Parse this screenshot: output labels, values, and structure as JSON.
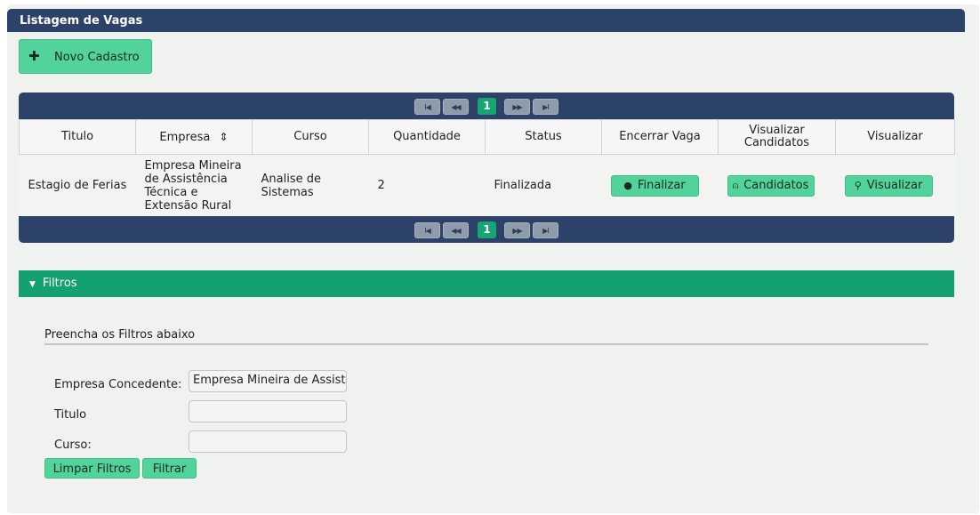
{
  "header": {
    "title": "Listagem de Vagas"
  },
  "toolbar": {
    "new_label": "Novo Cadastro"
  },
  "pager": {
    "first": "I◀",
    "prev": "◀◀",
    "current": "1",
    "next": "▶▶",
    "last": "▶I"
  },
  "table": {
    "columns": [
      "Titulo",
      "Empresa",
      "Curso",
      "Quantidade",
      "Status",
      "Encerrar Vaga",
      "Visualizar Candidatos",
      "Visualizar"
    ],
    "sort_icon": "⇕",
    "rows": [
      {
        "titulo": "Estagio de Ferias",
        "empresa": "Empresa Mineira de Assistência Técnica e Extensão Rural",
        "curso": "Analise de Sistemas",
        "quantidade": "2",
        "status": "Finalizada",
        "finalizar": "Finalizar",
        "candidatos": "Candidatos",
        "visualizar": "Visualizar"
      }
    ]
  },
  "filters": {
    "section_title": "Filtros",
    "instructions": "Preencha os Filtros abaixo",
    "empresa_label": "Empresa Concedente:",
    "empresa_value": "Empresa Mineira de Assistência Técnica e Extensão Rural",
    "titulo_label": "Titulo",
    "titulo_value": "",
    "curso_label": "Curso:",
    "curso_value": "",
    "clear_label": "Limpar Filtros",
    "filter_label": "Filtrar"
  },
  "colors": {
    "header_bg": "#2c4268",
    "accent_green": "#52d39b",
    "filter_bar": "#14a06f",
    "page_current": "#17a673"
  }
}
